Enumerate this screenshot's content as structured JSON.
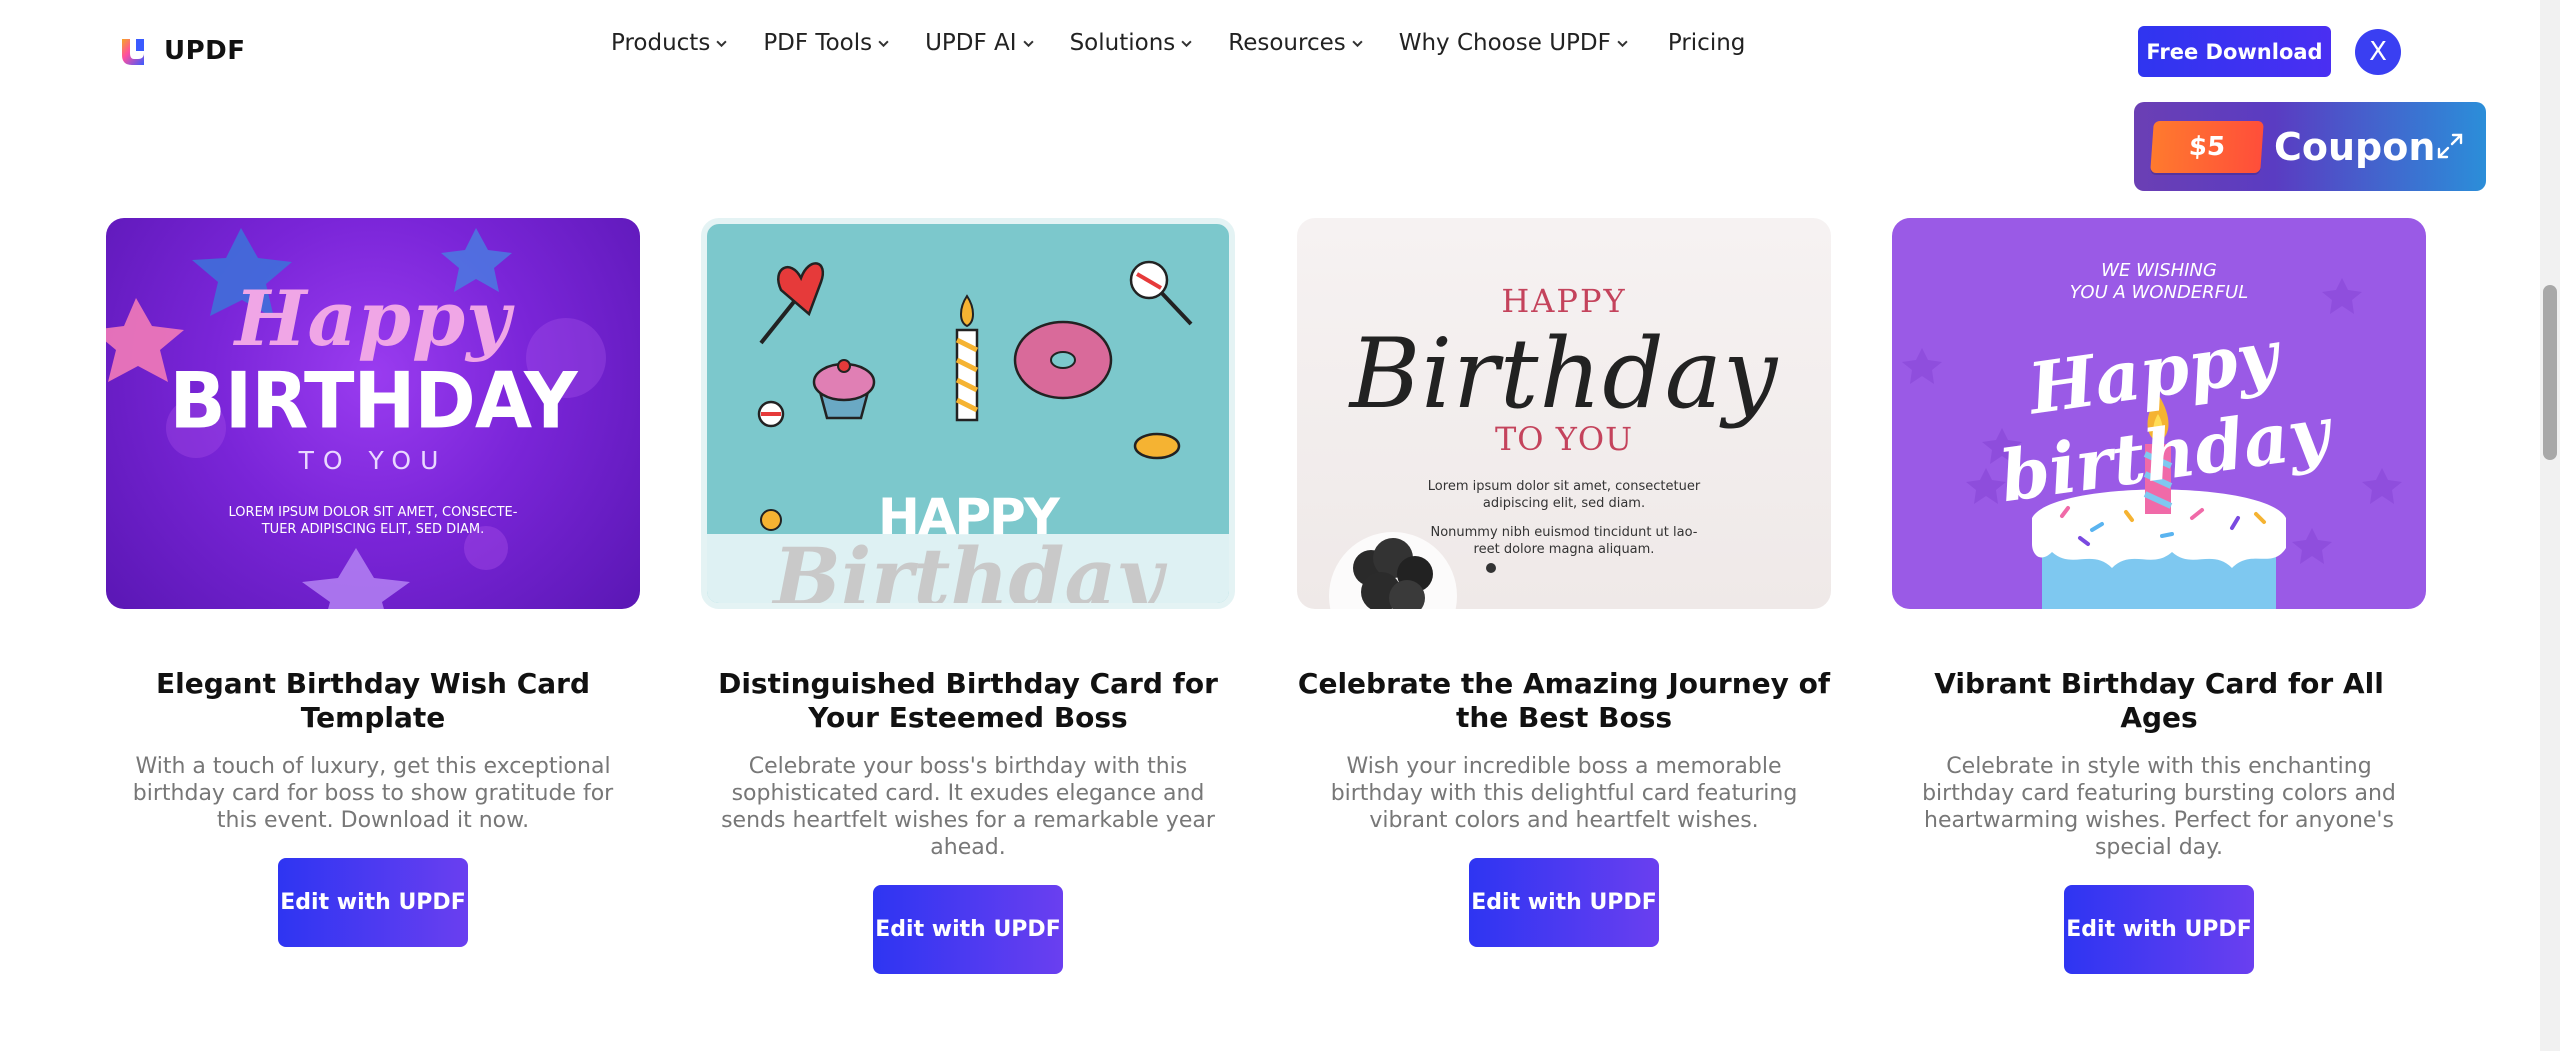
{
  "brand": {
    "name": "UPDF"
  },
  "nav": {
    "items": [
      {
        "label": "Products",
        "has_menu": true
      },
      {
        "label": "PDF Tools",
        "has_menu": true
      },
      {
        "label": "UPDF AI",
        "has_menu": true
      },
      {
        "label": "Solutions",
        "has_menu": true
      },
      {
        "label": "Resources",
        "has_menu": true
      },
      {
        "label": "Why Choose UPDF",
        "has_menu": true
      },
      {
        "label": "Pricing",
        "has_menu": false
      }
    ]
  },
  "header": {
    "free_download": "Free Download",
    "avatar_initial": "X"
  },
  "coupon": {
    "amount": "$5",
    "label": "Coupon",
    "icon": "expand-icon"
  },
  "cards": [
    {
      "title": "Elegant Birthday Wish Card Template",
      "description": "With a touch of luxury, get this exceptional birthday card for boss to show gratitude for this event. Download it now.",
      "button": "Edit with UPDF",
      "thumb": {
        "line1": "Happy",
        "line2": "BIRTHDAY",
        "line3": "TO YOU",
        "body": "LOREM IPSUM DOLOR SIT AMET, CONSECTE-\nTUER ADIPISCING ELIT, SED DIAM."
      }
    },
    {
      "title": "Distinguished Birthday Card for Your Esteemed Boss",
      "description": "Celebrate your boss's birthday with this sophisticated card. It exudes elegance and sends heartfelt wishes for a remarkable year ahead.",
      "button": "Edit with UPDF",
      "thumb": {
        "line1": "HAPPY",
        "line2": "Birthday"
      }
    },
    {
      "title": "Celebrate the Amazing Journey of the Best Boss",
      "description": "Wish your incredible boss a memorable birthday with this delightful card featuring vibrant colors and heartfelt wishes.",
      "button": "Edit with UPDF",
      "thumb": {
        "line1": "HAPPY",
        "line2": "Birthday",
        "line3": "TO YOU",
        "body1": "Lorem ipsum dolor sit amet, consectetuer\nadipiscing elit, sed diam.",
        "body2": "Nonummy nibh euismod tincidunt ut lao-\nreet dolore magna aliquam."
      }
    },
    {
      "title": "Vibrant Birthday Card for All Ages",
      "description": "Celebrate in style with this enchanting birthday card featuring bursting colors and heartwarming wishes. Perfect for anyone's special day.",
      "button": "Edit with UPDF",
      "thumb": {
        "line1": "WE WISHING\nYOU A WONDERFUL",
        "line2": "Happy birthday"
      }
    }
  ]
}
